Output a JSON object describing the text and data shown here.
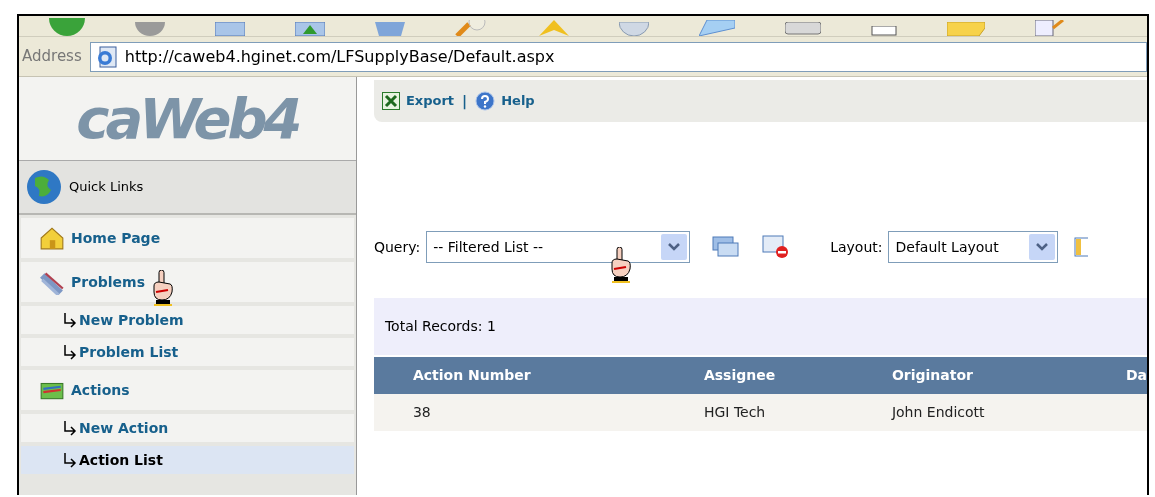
{
  "browser": {
    "address_label": "Address",
    "url": "http://caweb4.hginet.com/LFSupplyBase/Default.aspx"
  },
  "sidebar": {
    "logo": "caWeb4",
    "quick_links": "Quick Links",
    "items": [
      {
        "label": "Home Page",
        "kind": "section",
        "selected": false
      },
      {
        "label": "Problems",
        "kind": "section",
        "selected": false
      },
      {
        "label": "New Problem",
        "kind": "link",
        "selected": false
      },
      {
        "label": "Problem List",
        "kind": "link",
        "selected": false
      },
      {
        "label": "Actions",
        "kind": "section",
        "selected": false
      },
      {
        "label": "New Action",
        "kind": "link",
        "selected": false
      },
      {
        "label": "Action List",
        "kind": "link",
        "selected": true
      }
    ]
  },
  "toolbar": {
    "items": [
      {
        "label": "Export"
      },
      {
        "label": "Help"
      }
    ],
    "separator": "|"
  },
  "query": {
    "label": "Query:",
    "value": "-- Filtered List --"
  },
  "layout": {
    "label": "Layout:",
    "value": "Default Layout"
  },
  "total_records": "Total Records: 1",
  "table": {
    "columns": [
      "Action Number",
      "Assignee",
      "Originator",
      "Da"
    ],
    "rows": [
      [
        "38",
        "HGI Tech",
        "John Endicott"
      ]
    ]
  }
}
